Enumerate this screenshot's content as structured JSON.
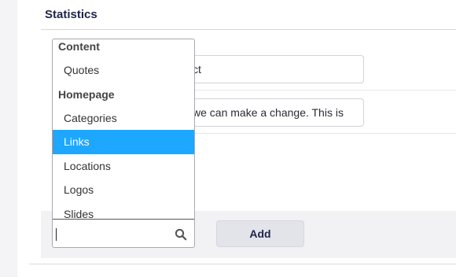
{
  "section": {
    "title": "Statistics"
  },
  "fields": [
    {
      "value": "ct"
    },
    {
      "value": "we can make a change. This is"
    }
  ],
  "dropdown": {
    "entries": [
      {
        "kind": "group",
        "label": "Content"
      },
      {
        "kind": "item",
        "label": "Quotes"
      },
      {
        "kind": "group",
        "label": "Homepage"
      },
      {
        "kind": "item",
        "label": "Categories"
      },
      {
        "kind": "item",
        "label": "Links",
        "selected": true
      },
      {
        "kind": "item",
        "label": "Locations"
      },
      {
        "kind": "item",
        "label": "Logos"
      },
      {
        "kind": "item",
        "label": "Slides"
      }
    ],
    "search": {
      "value": "",
      "icon": "search-icon"
    },
    "selected_color": "#1ea7ff"
  },
  "actions": {
    "add_label": "Add"
  }
}
